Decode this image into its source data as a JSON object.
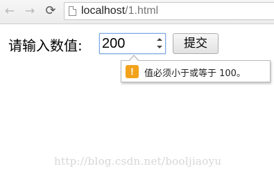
{
  "browser": {
    "back_icon": "←",
    "forward_icon": "→",
    "reload_icon": "⟳",
    "url_host": "localhost",
    "url_path": "/1.html"
  },
  "form": {
    "label": "请输入数值:",
    "value": "200",
    "submit_label": "提交"
  },
  "tooltip": {
    "icon_glyph": "!",
    "message": "值必须小于或等于 100。"
  },
  "watermark": "http://blog.csdn.net/booljiaoyu"
}
